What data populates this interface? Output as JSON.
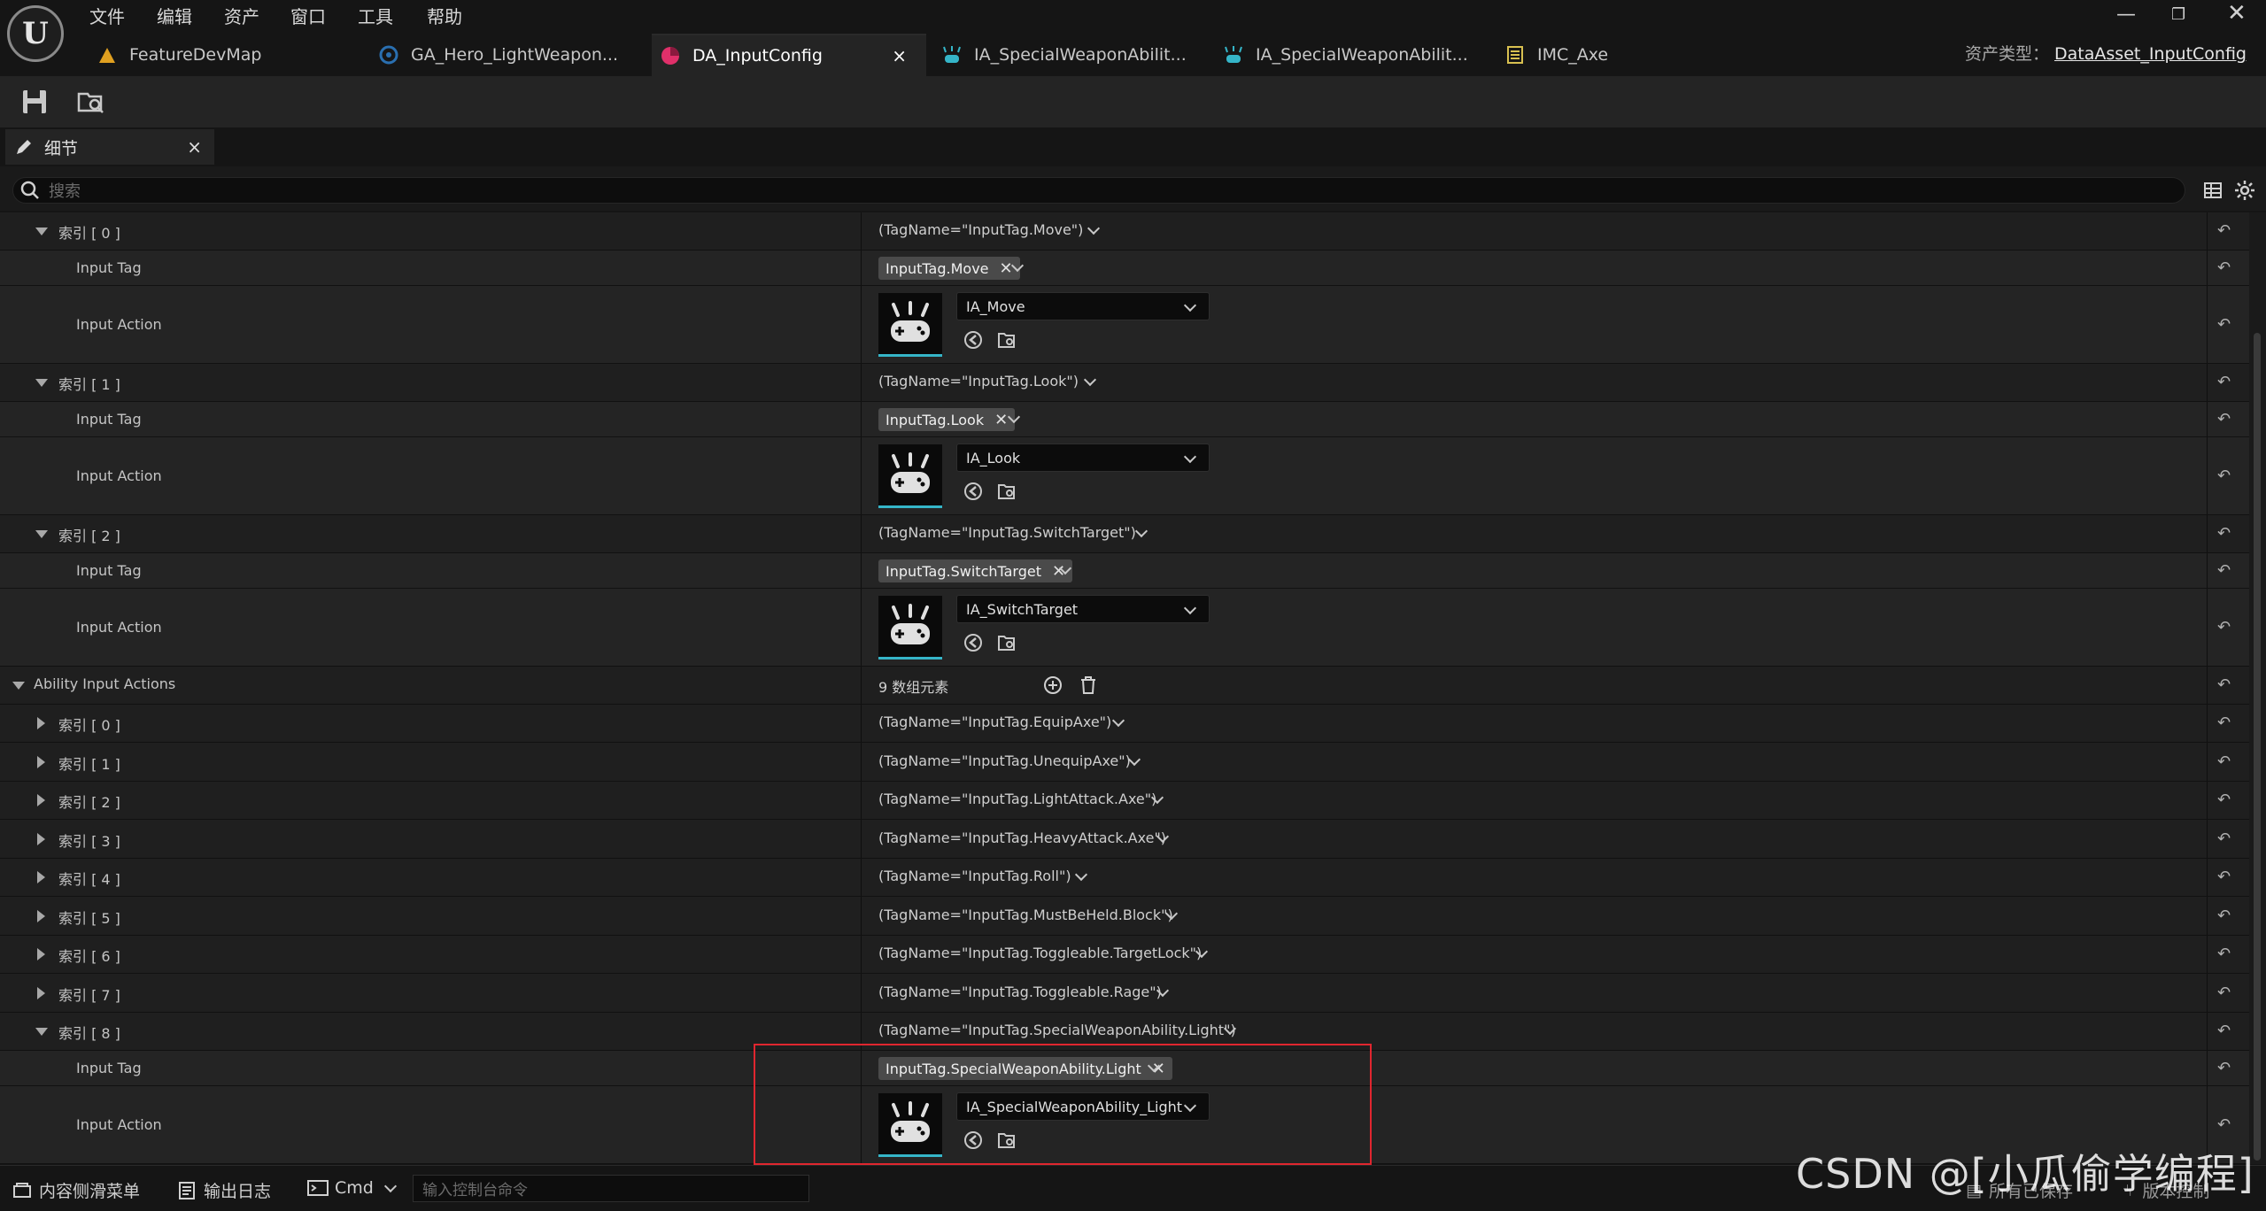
{
  "menu": [
    "文件",
    "编辑",
    "资产",
    "窗口",
    "工具",
    "帮助"
  ],
  "window_controls": [
    "minimize-icon",
    "restore-icon",
    "close-icon"
  ],
  "tabs": [
    {
      "label": "FeatureDevMap",
      "icon": "level-icon",
      "color": "#e0a020"
    },
    {
      "label": "GA_Hero_LightWeapon...",
      "icon": "blueprint-icon",
      "color": "#2a6fb0"
    },
    {
      "label": "DA_InputConfig",
      "icon": "data-asset-icon",
      "color": "#e0306a",
      "close": "×"
    },
    {
      "label": "IA_SpecialWeaponAbilit...",
      "icon": "input-action-icon",
      "color": "#35b5c8"
    },
    {
      "label": "IA_SpecialWeaponAbilit...",
      "icon": "input-action-icon",
      "color": "#35b5c8"
    },
    {
      "label": "IMC_Axe",
      "icon": "mapping-context-icon",
      "color": "#d8c050"
    }
  ],
  "asset_type": {
    "label": "资产类型：",
    "value": "DataAsset_InputConfig"
  },
  "details_tab": {
    "label": "细节",
    "close": "×"
  },
  "search": {
    "placeholder": "搜索"
  },
  "native_entries": [
    {
      "index": "索引 [ 0 ]",
      "summary": "(TagName=\"InputTag.Move\")",
      "tag": "InputTag.Move",
      "action": "IA_Move"
    },
    {
      "index": "索引 [ 1 ]",
      "summary": "(TagName=\"InputTag.Look\")",
      "tag": "InputTag.Look",
      "action": "IA_Look"
    },
    {
      "index": "索引 [ 2 ]",
      "summary": "(TagName=\"InputTag.SwitchTarget\")",
      "tag": "InputTag.SwitchTarget",
      "action": "IA_SwitchTarget"
    }
  ],
  "labels": {
    "input_tag": "Input Tag",
    "input_action": "Input Action"
  },
  "ability_section": {
    "label": "Ability Input Actions",
    "count": "9 数组元素"
  },
  "ability_entries": [
    {
      "index": "索引 [ 0 ]",
      "summary": "(TagName=\"InputTag.EquipAxe\")"
    },
    {
      "index": "索引 [ 1 ]",
      "summary": "(TagName=\"InputTag.UnequipAxe\")"
    },
    {
      "index": "索引 [ 2 ]",
      "summary": "(TagName=\"InputTag.LightAttack.Axe\")"
    },
    {
      "index": "索引 [ 3 ]",
      "summary": "(TagName=\"InputTag.HeavyAttack.Axe\")"
    },
    {
      "index": "索引 [ 4 ]",
      "summary": "(TagName=\"InputTag.Roll\")"
    },
    {
      "index": "索引 [ 5 ]",
      "summary": "(TagName=\"InputTag.MustBeHeld.Block\")"
    },
    {
      "index": "索引 [ 6 ]",
      "summary": "(TagName=\"InputTag.Toggleable.TargetLock\")"
    },
    {
      "index": "索引 [ 7 ]",
      "summary": "(TagName=\"InputTag.Toggleable.Rage\")"
    },
    {
      "index": "索引 [ 8 ]",
      "summary": "(TagName=\"InputTag.SpecialWeaponAbility.Light\")",
      "tag": "InputTag.SpecialWeaponAbility.Light",
      "action": "IA_SpecialWeaponAbility_Light"
    }
  ],
  "statusbar": {
    "content_drawer": "内容侧滑菜单",
    "output_log": "输出日志",
    "cmd": "Cmd",
    "console_placeholder": "输入控制台命令",
    "saved": "所有已保存",
    "source_control": "版本控制"
  },
  "watermark": "CSDN @[小瓜偷学编程]",
  "colors": {
    "accent": "#35b5c8",
    "highlight": "#e0262f",
    "active_tab_icon": "#e0306a"
  }
}
